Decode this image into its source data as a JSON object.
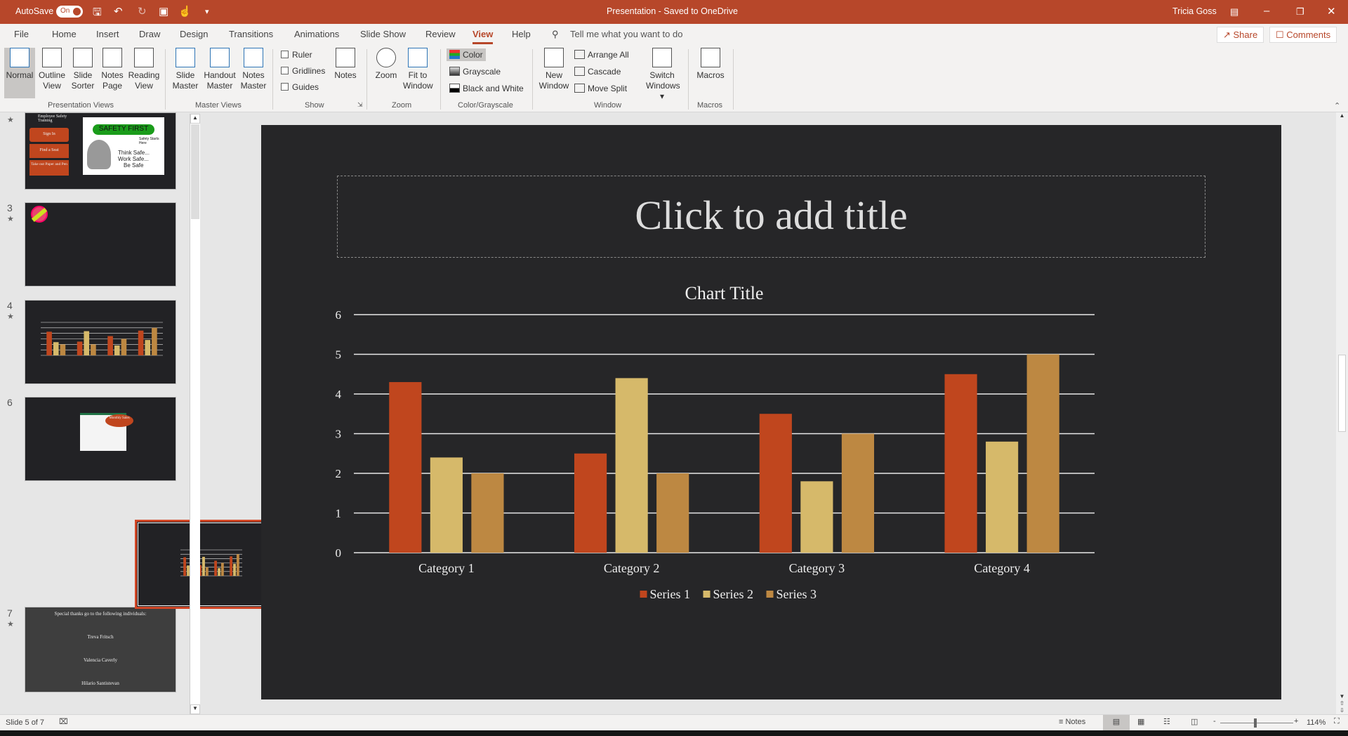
{
  "titlebar": {
    "autosave": "AutoSave",
    "autosave_state": "On",
    "doc_title": "Presentation  -  Saved to OneDrive",
    "user": "Tricia Goss",
    "accent": "#b7472a"
  },
  "tabs": [
    "File",
    "Home",
    "Insert",
    "Draw",
    "Design",
    "Transitions",
    "Animations",
    "Slide Show",
    "Review",
    "View",
    "Help"
  ],
  "active_tab": "View",
  "search_placeholder": "Tell me what you want to do",
  "share": "Share",
  "comments": "Comments",
  "ribbon": {
    "presentation_views": {
      "label": "Presentation Views",
      "items": [
        "Normal",
        "Outline View",
        "Slide Sorter",
        "Notes Page",
        "Reading View"
      ]
    },
    "master_views": {
      "label": "Master Views",
      "items": [
        "Slide Master",
        "Handout Master",
        "Notes Master"
      ]
    },
    "show": {
      "label": "Show",
      "checks": [
        "Ruler",
        "Gridlines",
        "Guides"
      ],
      "notes": "Notes"
    },
    "zoom": {
      "label": "Zoom",
      "items": [
        "Zoom",
        "Fit to Window"
      ]
    },
    "color": {
      "label": "Color/Grayscale",
      "items": [
        "Color",
        "Grayscale",
        "Black and White"
      ]
    },
    "window": {
      "label": "Window",
      "new_window": "New Window",
      "items": [
        "Arrange All",
        "Cascade",
        "Move Split"
      ],
      "switch": "Switch Windows"
    },
    "macros": {
      "label": "Macros",
      "item": "Macros"
    }
  },
  "thumbnails": {
    "slide2": {
      "title": "Employee Safety Training",
      "steps": [
        "Sign In",
        "Find a Seat",
        "Take out Paper and Pen"
      ],
      "badge": "SAFETY FIRST",
      "sign": "Safety Starts Here",
      "lines": [
        "Think Safe...",
        "Work Safe...",
        "Be Safe"
      ]
    },
    "slide3": {
      "num": "3"
    },
    "slide4": {
      "num": "4"
    },
    "slide6": {
      "num": "6",
      "callout": "Monthly Sales"
    },
    "slide7": {
      "num": "7",
      "heading": "Special thanks go to the following individuals:",
      "names": [
        "Treva Fritsch",
        "Valencia Caverly",
        "Hilario Santistevan"
      ]
    }
  },
  "slide": {
    "title_placeholder": "Click to add title"
  },
  "chart_data": {
    "type": "bar",
    "title": "Chart Title",
    "categories": [
      "Category 1",
      "Category 2",
      "Category 3",
      "Category 4"
    ],
    "series": [
      {
        "name": "Series 1",
        "values": [
          4.3,
          2.5,
          3.5,
          4.5
        ],
        "color": "#c0461e"
      },
      {
        "name": "Series 2",
        "values": [
          2.4,
          4.4,
          1.8,
          2.8
        ],
        "color": "#d6b96a"
      },
      {
        "name": "Series 3",
        "values": [
          2,
          2,
          3,
          5
        ],
        "color": "#bd8842"
      }
    ],
    "ylim": [
      0,
      6
    ],
    "yticks": [
      "0",
      "1",
      "2",
      "3",
      "4",
      "5",
      "6"
    ],
    "grid": true,
    "legend": "bottom"
  },
  "status": {
    "slide": "Slide 5 of 7",
    "notes": "Notes",
    "zoom": "114%",
    "zoom_level": 114
  }
}
